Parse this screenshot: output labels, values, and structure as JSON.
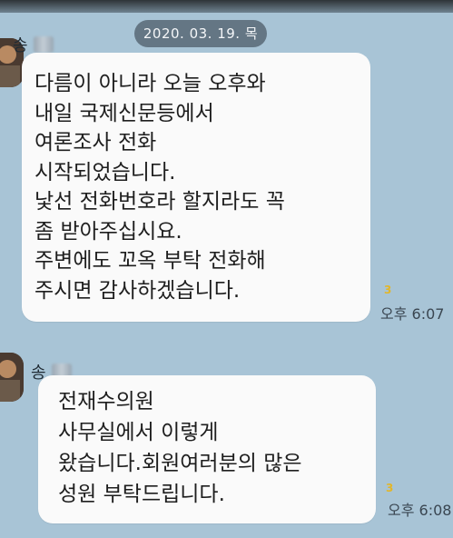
{
  "date_separator": "2020. 03. 19. 목",
  "messages": [
    {
      "sender": "송",
      "lines": [
        "다름이 아니라 오늘 오후와",
        "내일 국제신문등에서",
        "여론조사 전화",
        "시작되었습니다.",
        "낯선 전화번호라 할지라도 꼭",
        "좀 받아주십시요.",
        "주변에도 꼬옥 부탁 전화해",
        "주시면 감사하겠습니다."
      ],
      "unread": "3",
      "time": "오후 6:07"
    },
    {
      "sender": "송",
      "lines": [
        "전재수의원",
        "사무실에서 이렇게",
        "왔습니다.회원여러분의 많은",
        "성원 부탁드립니다."
      ],
      "unread": "3",
      "time": "오후 6:08"
    }
  ],
  "colors": {
    "background": "#a8c4d6",
    "bubble": "#fafafa",
    "unread": "#e2b62a"
  }
}
